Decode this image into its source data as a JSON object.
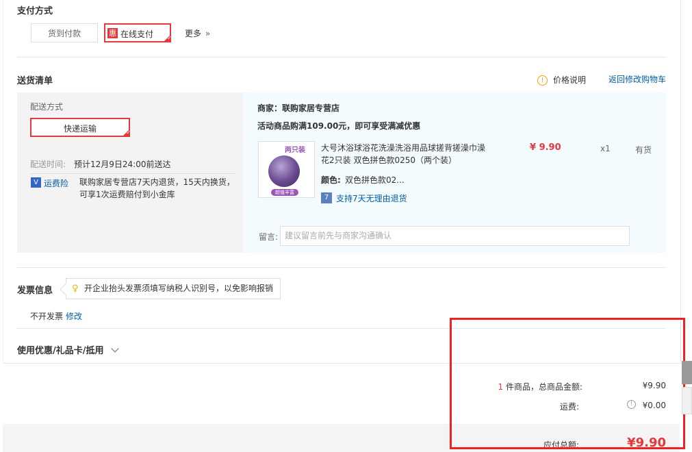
{
  "payment": {
    "title": "支付方式",
    "cod_label": "货到付款",
    "online_badge": "惠",
    "online_label": "在线支付",
    "more_label": "更多",
    "more_icon": "»"
  },
  "delivery": {
    "title": "送货清单",
    "price_note_label": "价格说明",
    "return_cart_label": "返回修改购物车",
    "method_title": "配送方式",
    "method_value": "快递运输",
    "time_label": "配送时间:",
    "time_value": "预计12月9日24:00前送达",
    "insurance_label": "运费险",
    "insurance_text": "联购家居专营店7天内退货，15天内换货，可享1次运费赔付到小金库"
  },
  "order": {
    "merchant": "商家：联购家居专营店",
    "promo": "活动商品购满109.00元，即可享受满减优惠",
    "product_thumb_tag": "两只装",
    "product_thumb_footer": "超值丰富",
    "product_name": "大号沐浴球浴花洗澡洗浴用品球搓背搓澡巾澡花2只装 双色拼色款0250（两个装）",
    "price": "¥ 9.90",
    "qty": "x1",
    "stock": "有货",
    "color_label": "颜色:",
    "color_value": "双色拼色款02...",
    "return_policy": "支持7天无理由退货",
    "note_label": "留言:",
    "note_placeholder": "建议留言前先与商家沟通确认"
  },
  "invoice": {
    "title": "发票信息",
    "tip": "开企业抬头发票须填写纳税人识别号，以免影响报销",
    "status": "不开发票",
    "edit_label": "修改"
  },
  "coupon": {
    "title": "使用优惠/礼品卡/抵用"
  },
  "summary": {
    "count": "1",
    "count_suffix": "件商品，总商品金额:",
    "goods_total": "¥9.90",
    "shipping_label": "运费:",
    "shipping_value": "¥0.00",
    "payable_label": "应付总额:",
    "payable_value": "¥9.90"
  },
  "colors": {
    "accent_red": "#e4393c",
    "link_blue": "#005ea7",
    "panel_blue": "#f3fbfe",
    "panel_gray": "#f3f3f3"
  }
}
